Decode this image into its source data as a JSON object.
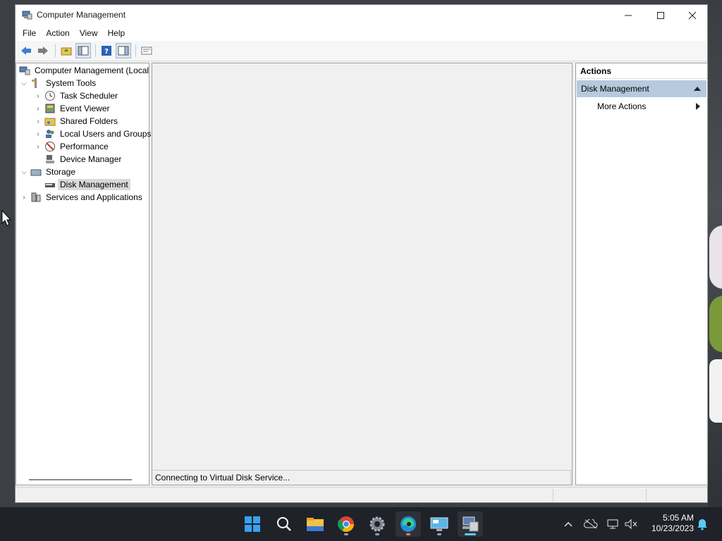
{
  "window": {
    "title": "Computer Management",
    "minimize_label": "—",
    "maximize_label": "☐",
    "close_label": "✕"
  },
  "menu": [
    "File",
    "Action",
    "View",
    "Help"
  ],
  "tree": {
    "root": "Computer Management (Local",
    "system_tools": "System Tools",
    "task_scheduler": "Task Scheduler",
    "event_viewer": "Event Viewer",
    "shared_folders": "Shared Folders",
    "local_users": "Local Users and Groups",
    "performance": "Performance",
    "device_manager": "Device Manager",
    "storage": "Storage",
    "disk_management": "Disk Management",
    "services": "Services and Applications"
  },
  "center": {
    "status": "Connecting to Virtual Disk Service..."
  },
  "actions": {
    "header": "Actions",
    "section": "Disk Management",
    "more_actions": "More Actions"
  },
  "taskbar": {
    "time": "5:05 AM",
    "date": "10/23/2023",
    "apps": [
      "start-icon",
      "search-icon",
      "file-explorer-icon",
      "chrome-icon",
      "settings-icon",
      "edge-icon",
      "remote-desktop-icon",
      "computer-management-icon"
    ]
  },
  "colors": {
    "selected_section": "#b6c9de",
    "taskbar": "#1f2228",
    "accent": "#5cc8ff"
  }
}
